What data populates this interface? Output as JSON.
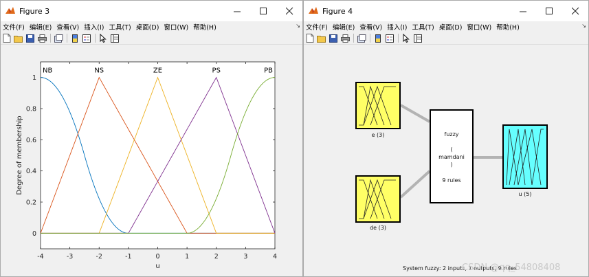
{
  "figure3": {
    "title": "Figure 3",
    "menu": [
      "文件(F)",
      "编辑(E)",
      "查看(V)",
      "插入(I)",
      "工具(T)",
      "桌面(D)",
      "窗口(W)",
      "帮助(H)"
    ]
  },
  "figure4": {
    "title": "Figure 4",
    "menu": [
      "文件(F)",
      "编辑(E)",
      "查看(V)",
      "插入(I)",
      "工具(T)",
      "桌面(D)",
      "窗口(W)",
      "帮助(H)"
    ],
    "input1_label": "e (3)",
    "input2_label": "de (3)",
    "output_label": "u (5)",
    "system_line1": "fuzzy",
    "system_line2": "(",
    "system_line3": "mamdani",
    "system_line4": ")",
    "system_rules": "9 rules",
    "status_text": "System fuzzy: 2 inputs, 1 outputs, 9 rules",
    "watermark": "CSDN @qq_54808408"
  },
  "colors": {
    "NB": "#0072BD",
    "NS": "#D95319",
    "ZE": "#EDB120",
    "PS": "#7E2F8E",
    "PB": "#77AC30",
    "input_box": "#ffff66",
    "output_box": "#66ffff"
  },
  "chart_data": {
    "type": "line",
    "xlabel": "u",
    "ylabel": "Degree of membership",
    "xlim": [
      -4,
      4
    ],
    "ylim": [
      -0.1,
      1.1
    ],
    "xticks": [
      -4,
      -3,
      -2,
      -1,
      0,
      1,
      2,
      3,
      4
    ],
    "yticks": [
      0,
      0.2,
      0.4,
      0.6,
      0.8,
      1
    ],
    "grid": false,
    "series": [
      {
        "name": "NB",
        "shape": "zmf",
        "params": [
          -4,
          -1
        ],
        "peak_x": -4
      },
      {
        "name": "NS",
        "shape": "trimf",
        "params": [
          -4,
          -2,
          1
        ],
        "peak_x": -2
      },
      {
        "name": "ZE",
        "shape": "trimf",
        "params": [
          -2,
          0,
          2
        ],
        "peak_x": 0
      },
      {
        "name": "PS",
        "shape": "trimf",
        "params": [
          -1,
          2,
          4
        ],
        "peak_x": 2
      },
      {
        "name": "PB",
        "shape": "smf",
        "params": [
          1,
          4
        ],
        "peak_x": 4
      }
    ]
  }
}
